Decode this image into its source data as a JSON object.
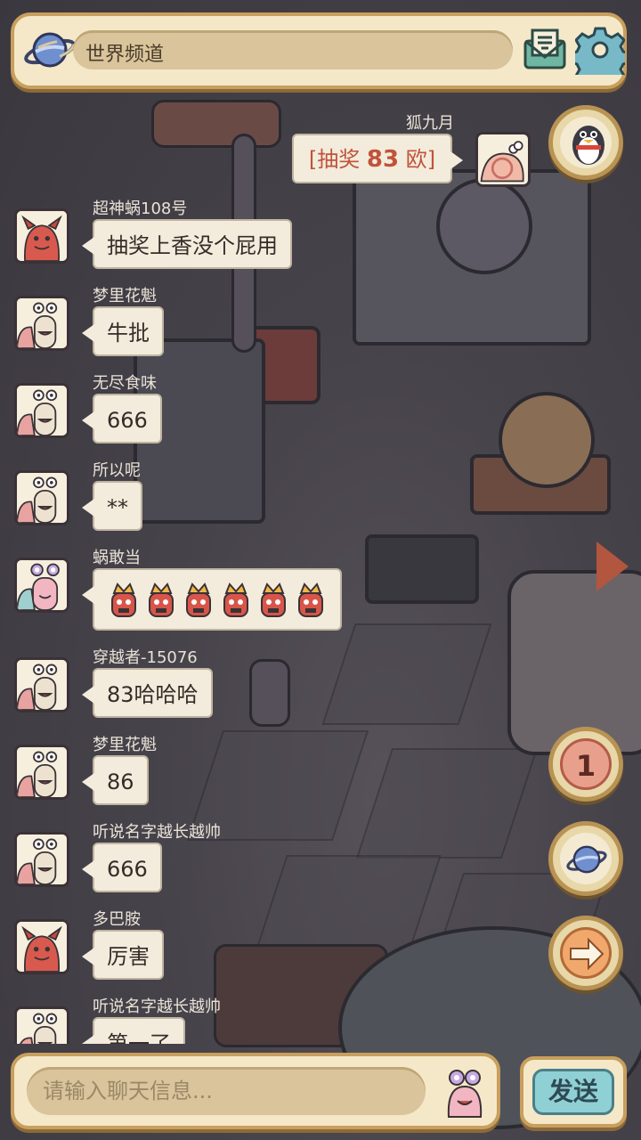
{
  "header": {
    "channel_label": "世界频道",
    "planet_icon": "planet-icon",
    "mail_icon": "mail-icon",
    "settings_icon": "gear-icon"
  },
  "own_message": {
    "name": "狐九月",
    "prefix": "[抽奖 ",
    "number": "83",
    "suffix": " 欧]"
  },
  "messages": [
    {
      "name": "超神蜗108号",
      "text": "抽奖上香没个屁用",
      "avatar": "red-demon"
    },
    {
      "name": "梦里花魁",
      "text": "牛批",
      "avatar": "snail"
    },
    {
      "name": "无尽食味",
      "text": "666",
      "avatar": "snail"
    },
    {
      "name": "所以呢",
      "text": "**",
      "avatar": "snail"
    },
    {
      "name": "蜗敢当",
      "text": "",
      "avatar": "pink-snail",
      "emoji_count": 6
    },
    {
      "name": "穿越者-15076",
      "text": "83哈哈哈",
      "avatar": "snail"
    },
    {
      "name": "梦里花魁",
      "text": "86",
      "avatar": "snail"
    },
    {
      "name": "听说名字越长越帅",
      "text": "666",
      "avatar": "snail"
    },
    {
      "name": "多巴胺",
      "text": "厉害",
      "avatar": "red-demon"
    },
    {
      "name": "听说名字越长越帅",
      "text": "第一了",
      "avatar": "snail"
    }
  ],
  "side": {
    "notification_count": "1"
  },
  "composer": {
    "placeholder": "请输入聊天信息...",
    "send_label": "发送"
  },
  "colors": {
    "panel": "#f4e8c8",
    "panel_border": "#c99f5d",
    "bubble": "#f3ecdd",
    "accent_red": "#c0533a",
    "send_button": "#8fd0d5"
  }
}
